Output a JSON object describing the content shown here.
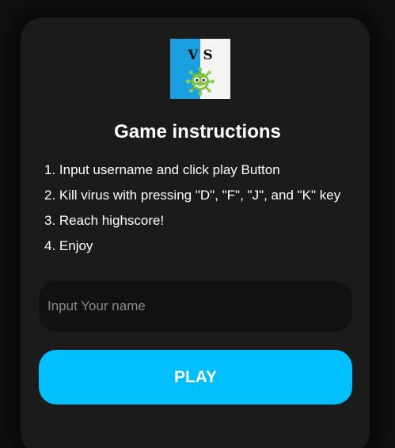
{
  "logo": {
    "text": "VS",
    "icon": "virus-icon",
    "colors": {
      "left": "#1a9fe0",
      "right": "#f4f4f4",
      "virus": "#7cc443"
    }
  },
  "title": "Game instructions",
  "instructions": [
    "1. Input username and click play Button",
    "2. Kill virus with pressing \"D\", \"F\", \"J\", and \"K\" key",
    "3. Reach highscore!",
    "4. Enjoy"
  ],
  "name_input": {
    "placeholder": "Input Your name",
    "value": ""
  },
  "play_button": {
    "label": "PLAY"
  },
  "colors": {
    "background": "#111111",
    "card": "#1b1b1b",
    "accent": "#00bfff"
  }
}
